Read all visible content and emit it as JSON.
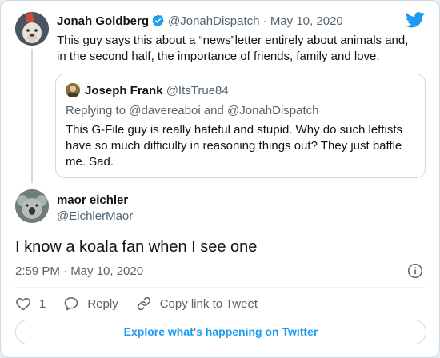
{
  "first_tweet": {
    "author_name": "Jonah Goldberg",
    "author_handle": "@JonahDispatch",
    "separator": "·",
    "date": "May 10, 2020",
    "text": "This guy says this about a “news”letter entirely about animals and, in the second half, the importance of friends, family and love.",
    "quote": {
      "author_name": "Joseph Frank",
      "author_handle": "@ItsTrue84",
      "replying_to": "Replying to @davereaboi and @JonahDispatch",
      "text": "This G-File guy is really hateful and stupid.  Why do such leftists have so much difficulty in reasoning things out?  They just baffle me.  Sad."
    }
  },
  "main_tweet": {
    "author_name": "maor eichler",
    "author_handle": "@EichlerMaor",
    "text": "I know a koala fan when I see one",
    "timestamp": "2:59 PM · May 10, 2020"
  },
  "actions": {
    "like_count": "1",
    "reply_label": "Reply",
    "copy_link_label": "Copy link to Tweet"
  },
  "explore_label": "Explore what's happening on Twitter",
  "colors": {
    "twitter_blue": "#1d9bf0",
    "muted_text": "#536471",
    "border": "#cfd9de"
  },
  "icons": {
    "verified": "verified-badge-icon",
    "brand": "twitter-bird-icon",
    "info": "info-icon",
    "like": "heart-icon",
    "reply": "speech-bubble-icon",
    "copy_link": "link-icon"
  }
}
